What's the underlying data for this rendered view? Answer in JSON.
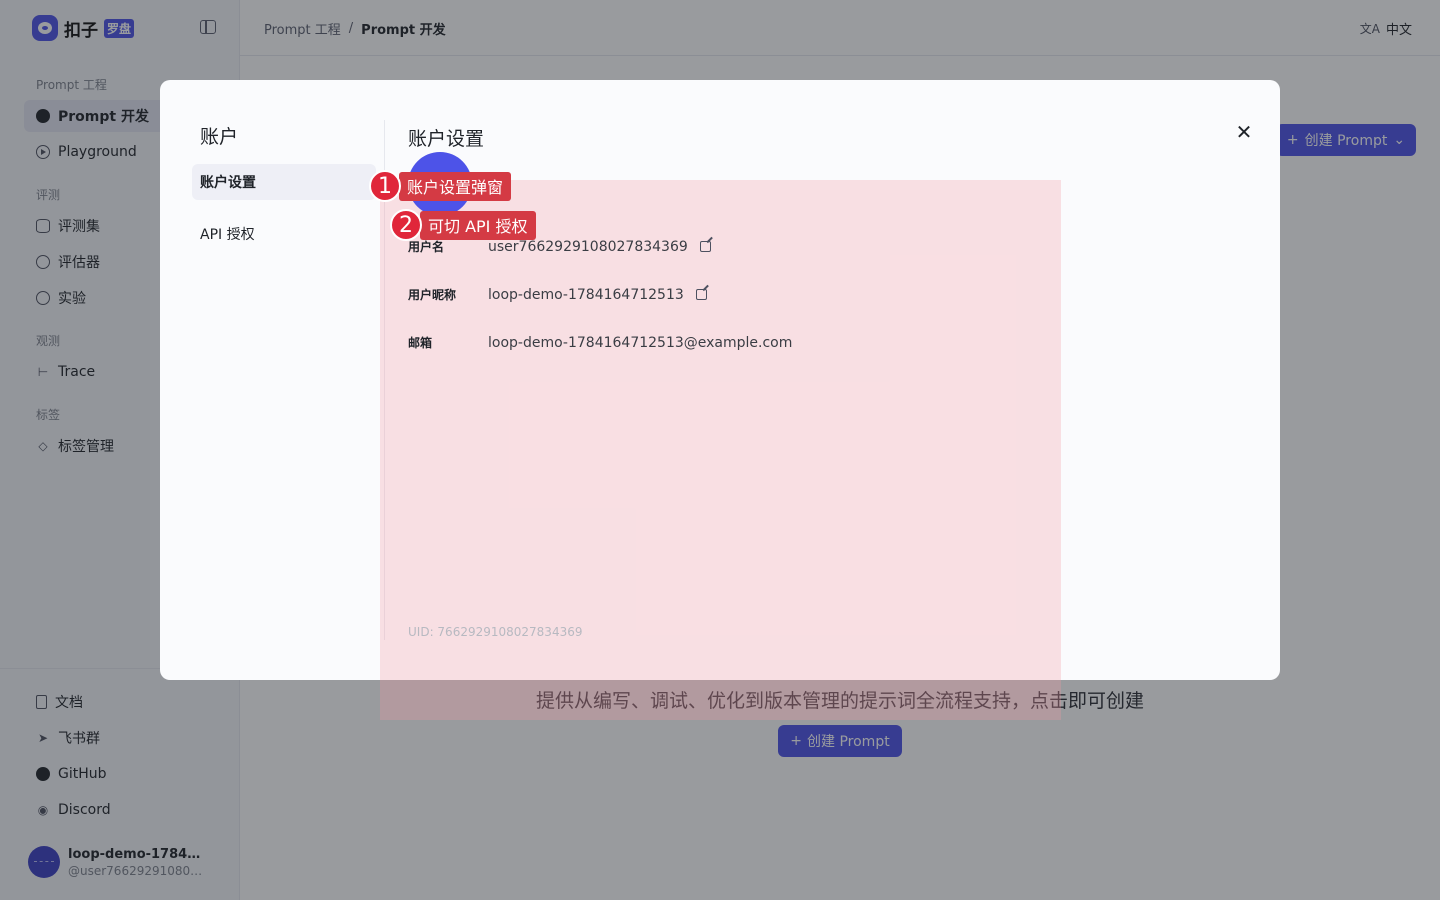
{
  "brand": {
    "name": "扣子",
    "badge": "罗盘"
  },
  "sidebar": {
    "groups": [
      {
        "title": "Prompt 工程",
        "items": [
          {
            "label": "Prompt 开发",
            "icon": "prompt-icon",
            "active": true
          },
          {
            "label": "Playground",
            "icon": "play-icon"
          }
        ]
      },
      {
        "title": "评测",
        "items": [
          {
            "label": "评测集",
            "icon": "database-icon"
          },
          {
            "label": "评估器",
            "icon": "bulb-icon"
          },
          {
            "label": "实验",
            "icon": "gauge-icon"
          }
        ]
      },
      {
        "title": "观测",
        "items": [
          {
            "label": "Trace",
            "icon": "trace-icon"
          }
        ]
      },
      {
        "title": "标签",
        "items": [
          {
            "label": "标签管理",
            "icon": "tag-icon"
          }
        ]
      }
    ],
    "bottom_items": [
      {
        "label": "文档",
        "icon": "doc-icon"
      },
      {
        "label": "飞书群",
        "icon": "feishu-icon"
      },
      {
        "label": "GitHub",
        "icon": "github-icon"
      },
      {
        "label": "Discord",
        "icon": "discord-icon"
      }
    ],
    "user": {
      "name": "loop-demo-1784164…",
      "handle": "@user7662929108027…"
    }
  },
  "topbar": {
    "breadcrumb": {
      "parent": "Prompt 工程",
      "separator": "/",
      "current": "Prompt 开发"
    },
    "language": "中文"
  },
  "main": {
    "create_button_top": "创建 Prompt",
    "empty_description": "提供从编写、调试、优化到版本管理的提示词全流程支持，点击即可创建",
    "create_button_center": "创建 Prompt"
  },
  "modal": {
    "nav_title": "账户",
    "nav_items": [
      {
        "label": "账户设置",
        "active": true
      },
      {
        "label": "API 授权"
      }
    ],
    "title": "账户设置",
    "fields": [
      {
        "label": "用户名",
        "value": "user7662929108027834369",
        "editable": true
      },
      {
        "label": "用户昵称",
        "value": "loop-demo-1784164712513",
        "editable": true
      },
      {
        "label": "邮箱",
        "value": "loop-demo-1784164712513@example.com",
        "editable": false
      }
    ],
    "uid": "UID: 7662929108027834369"
  },
  "annotations": [
    {
      "number": "1",
      "text": "账户设置弹窗"
    },
    {
      "number": "2",
      "text": "可切 API 授权"
    }
  ],
  "colors": {
    "accent": "#4d53e8",
    "annotation": "#e0263a",
    "highlight": "#f5969f"
  }
}
